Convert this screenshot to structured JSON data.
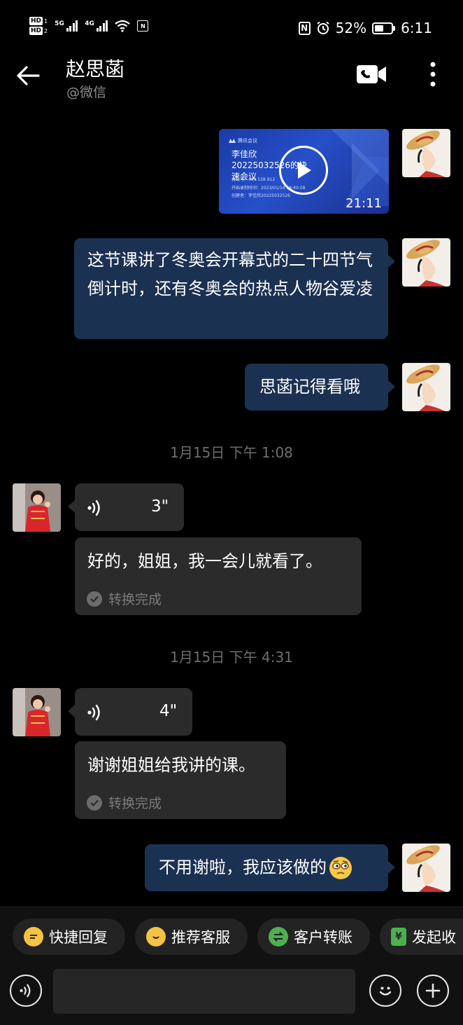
{
  "status_bar": {
    "hd1": "HD",
    "hd1_num": "1",
    "hd2": "HD",
    "hd2_num": "2",
    "sig1_label": "5G",
    "sig2_label": "4G",
    "nfc": "N",
    "battery_percent": "52%",
    "battery_level": 0.52,
    "time": "6:11"
  },
  "header": {
    "contact_name": "赵思菡",
    "contact_source": "@微信"
  },
  "messages": {
    "video": {
      "brand": "腾讯会议",
      "title": "李佳欣20225032526的快速会议",
      "meeting_id": "会议号：449 538 812",
      "start_time": "开始录制时间：2023/01/14 18:40:08",
      "creator": "创建者：李佳欣20225032526",
      "duration": "21:11"
    },
    "m1_text": "这节课讲了冬奥会开幕式的二十四节气倒计时，还有冬奥会的热点人物谷爱凌",
    "m2_text": "思菡记得看哦",
    "ts1": "1月15日  下午 1:08",
    "voice1": {
      "duration": "3\"",
      "transcript": "好的，姐姐，我一会儿就看了。",
      "status": "转换完成"
    },
    "ts2": "1月15日  下午 4:31",
    "voice2": {
      "duration": "4\"",
      "transcript": "谢谢姐姐给我讲的课。",
      "status": "转换完成"
    },
    "m3_text": "不用谢啦，我应该做的"
  },
  "quick_replies": [
    {
      "label": "快捷回复",
      "icon": "quick-reply-icon",
      "color": "#f5c242"
    },
    {
      "label": "推荐客服",
      "icon": "recommend-agent-icon",
      "color": "#f5c242"
    },
    {
      "label": "客户转账",
      "icon": "transfer-icon",
      "color": "#4caf50"
    },
    {
      "label": "发起收",
      "icon": "collect-money-icon",
      "color": "#4caf50"
    }
  ],
  "input": {
    "placeholder": ""
  },
  "colors": {
    "outgoing_bubble": "#1b3152",
    "incoming_bubble": "#2b2b2b",
    "background": "#000000"
  }
}
